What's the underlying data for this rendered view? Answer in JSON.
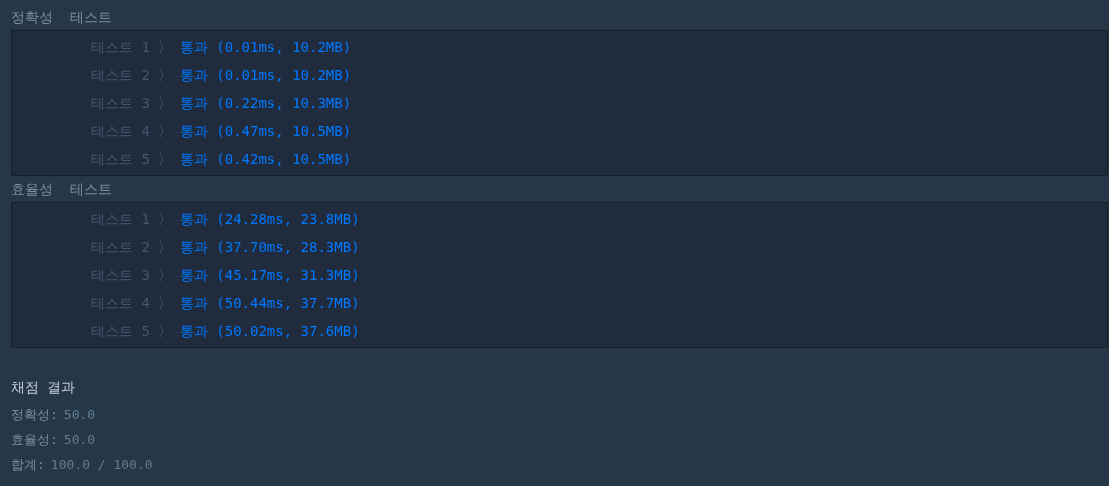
{
  "sections": [
    {
      "title": "정확성  테스트",
      "tests": [
        {
          "label": "테스트 1",
          "separator": "〉",
          "result": "통과 (0.01ms, 10.2MB)",
          "passed": true
        },
        {
          "label": "테스트 2",
          "separator": "〉",
          "result": "통과 (0.01ms, 10.2MB)",
          "passed": true
        },
        {
          "label": "테스트 3",
          "separator": "〉",
          "result": "통과 (0.22ms, 10.3MB)",
          "passed": true
        },
        {
          "label": "테스트 4",
          "separator": "〉",
          "result": "통과 (0.47ms, 10.5MB)",
          "passed": true
        },
        {
          "label": "테스트 5",
          "separator": "〉",
          "result": "통과 (0.42ms, 10.5MB)",
          "passed": true
        }
      ]
    },
    {
      "title": "효율성  테스트",
      "tests": [
        {
          "label": "테스트 1",
          "separator": "〉",
          "result": "통과 (24.28ms, 23.8MB)",
          "passed": true
        },
        {
          "label": "테스트 2",
          "separator": "〉",
          "result": "통과 (37.70ms, 28.3MB)",
          "passed": true
        },
        {
          "label": "테스트 3",
          "separator": "〉",
          "result": "통과 (45.17ms, 31.3MB)",
          "passed": true
        },
        {
          "label": "테스트 4",
          "separator": "〉",
          "result": "통과 (50.44ms, 37.7MB)",
          "passed": true
        },
        {
          "label": "테스트 5",
          "separator": "〉",
          "result": "통과 (50.02ms, 37.6MB)",
          "passed": true
        }
      ]
    }
  ],
  "summary": {
    "title": "채점 결과",
    "lines": [
      {
        "label": "정확성:",
        "value": "50.0"
      },
      {
        "label": "효율성:",
        "value": "50.0"
      },
      {
        "label": "합계:",
        "value": "100.0 / 100.0"
      }
    ]
  }
}
